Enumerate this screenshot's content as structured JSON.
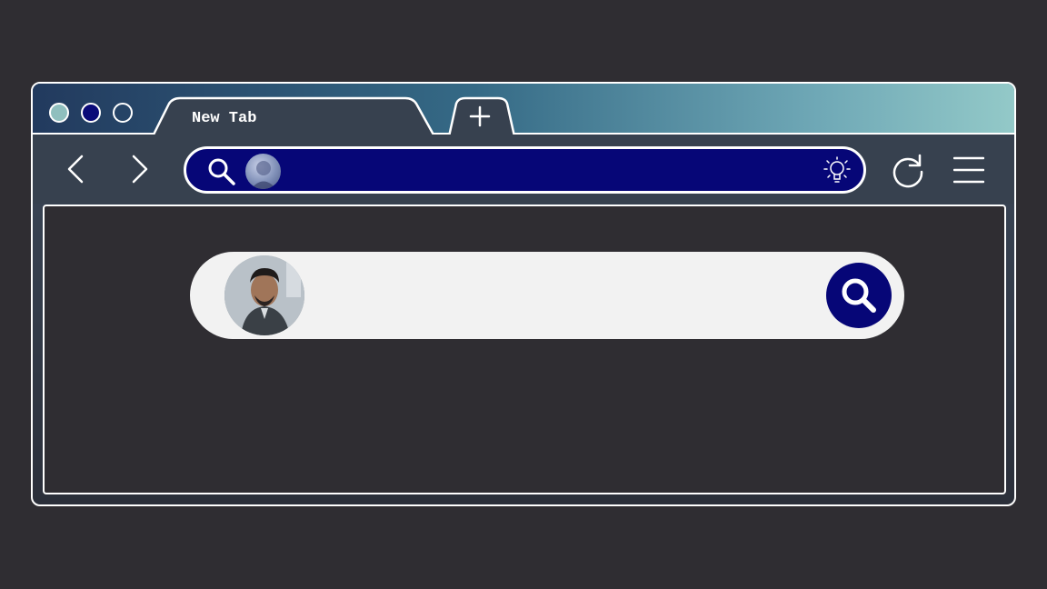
{
  "window": {
    "traffic_lights": [
      {
        "name": "teal",
        "color": "#8fbfbe"
      },
      {
        "name": "navy",
        "color": "#0a0a78"
      },
      {
        "name": "outline",
        "color": "transparent"
      }
    ]
  },
  "tabs": [
    {
      "label": "New Tab",
      "active": true
    }
  ],
  "new_tab_icon": "plus-icon",
  "toolbar": {
    "back_icon": "chevron-left-icon",
    "forward_icon": "chevron-right-icon",
    "address_bar": {
      "value": "",
      "search_icon": "search-icon",
      "avatar": "user-avatar",
      "right_icon": "lightbulb-icon"
    },
    "reload_icon": "reload-icon",
    "menu_icon": "hamburger-menu-icon"
  },
  "page": {
    "search_box": {
      "value": "",
      "avatar": "user-avatar",
      "submit_icon": "search-icon"
    }
  },
  "colors": {
    "background": "#2f2d32",
    "accent": "#060677",
    "search_box_bg": "#f2f2f2",
    "outline": "#ffffff"
  }
}
